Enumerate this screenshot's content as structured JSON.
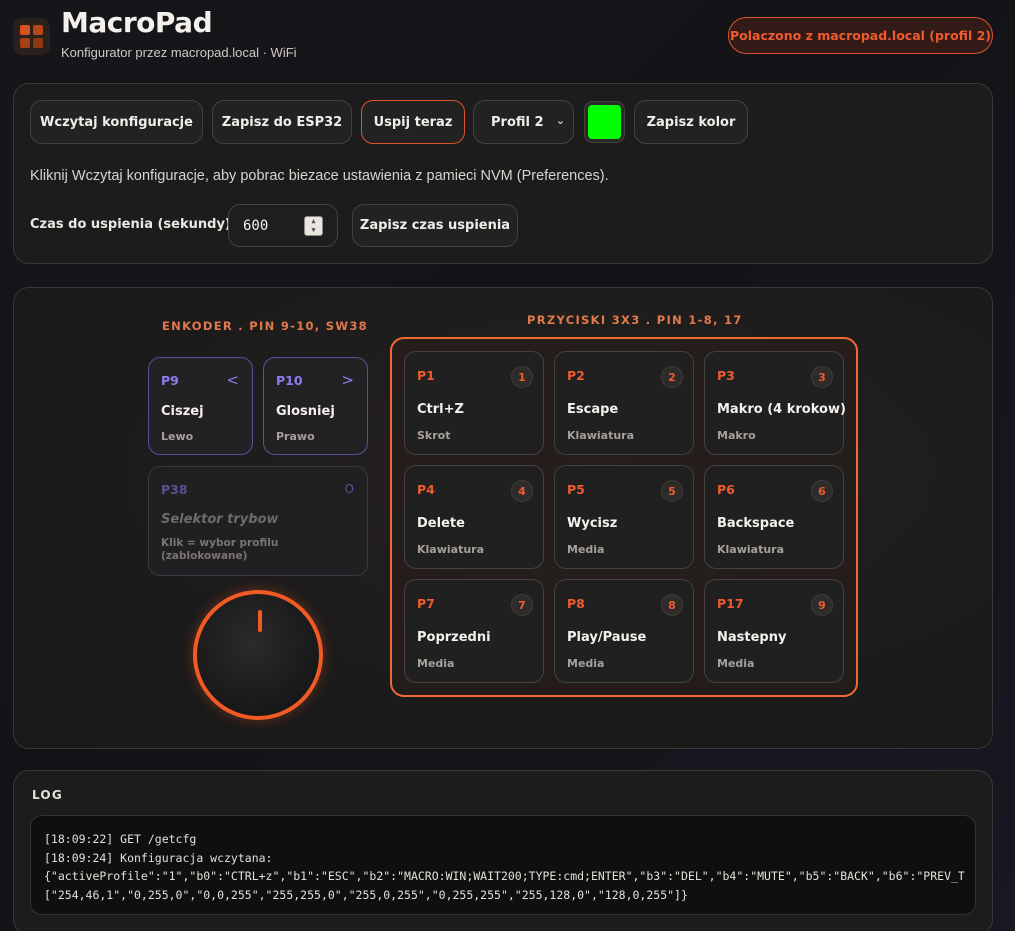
{
  "header": {
    "logo_icon": "keypad-grid-icon",
    "title": "MacroPad",
    "subtitle": "Konfigurator przez macropad.local · WiFi",
    "status": "Polaczono z macropad.local (profil 2)",
    "accent_color": "#f05a2e"
  },
  "toolbar": {
    "load_label": "Wczytaj konfiguracje",
    "save_label": "Zapisz do ESP32",
    "sleep_now_label": "Uspij teraz",
    "profile_selected": "Profil 2",
    "color_value": "#00ff00",
    "save_color_label": "Zapisz kolor",
    "hint": "Kliknij Wczytaj konfiguracje, aby pobrac biezace ustawienia z pamieci NVM (Preferences).",
    "sleep_label": "Czas do uspienia (sekundy):",
    "sleep_value": "600",
    "save_sleep_label": "Zapisz czas uspienia"
  },
  "encoder": {
    "heading": "ENKODER . PIN 9-10, SW38",
    "cards": [
      {
        "pin": "P9",
        "dir": "<",
        "action": "Ciszej",
        "sub": "Lewo"
      },
      {
        "pin": "P10",
        "dir": ">",
        "action": "Glosniej",
        "sub": "Prawo"
      }
    ],
    "switch": {
      "pin": "P38",
      "dir": "O",
      "action": "Selektor trybow",
      "sub": "Klik = wybor profilu (zablokowane)"
    },
    "knob_icon": "rotary-knob-icon"
  },
  "buttons": {
    "heading": "PRZYCISKI 3X3 . PIN 1-8, 17",
    "keys": [
      {
        "pin": "P1",
        "num": "1",
        "action": "Ctrl+Z",
        "type": "Skrot"
      },
      {
        "pin": "P2",
        "num": "2",
        "action": "Escape",
        "type": "Klawiatura"
      },
      {
        "pin": "P3",
        "num": "3",
        "action": "Makro (4 krokow)",
        "type": "Makro"
      },
      {
        "pin": "P4",
        "num": "4",
        "action": "Delete",
        "type": "Klawiatura"
      },
      {
        "pin": "P5",
        "num": "5",
        "action": "Wycisz",
        "type": "Media"
      },
      {
        "pin": "P6",
        "num": "6",
        "action": "Backspace",
        "type": "Klawiatura"
      },
      {
        "pin": "P7",
        "num": "7",
        "action": "Poprzedni",
        "type": "Media"
      },
      {
        "pin": "P8",
        "num": "8",
        "action": "Play/Pause",
        "type": "Media"
      },
      {
        "pin": "P17",
        "num": "9",
        "action": "Nastepny",
        "type": "Media"
      }
    ]
  },
  "log": {
    "heading": "LOG",
    "lines": [
      "[18:09:22] GET /getcfg",
      "[18:09:24] Konfiguracja wczytana:",
      "{\"activeProfile\":\"1\",\"b0\":\"CTRL+z\",\"b1\":\"ESC\",\"b2\":\"MACRO:WIN;WAIT200;TYPE:cmd;ENTER\",\"b3\":\"DEL\",\"b4\":\"MUTE\",\"b5\":\"BACK\",\"b6\":\"PREV_T",
      "[\"254,46,1\",\"0,255,0\",\"0,0,255\",\"255,255,0\",\"255,0,255\",\"0,255,255\",\"255,128,0\",\"128,0,255\"]}"
    ]
  }
}
